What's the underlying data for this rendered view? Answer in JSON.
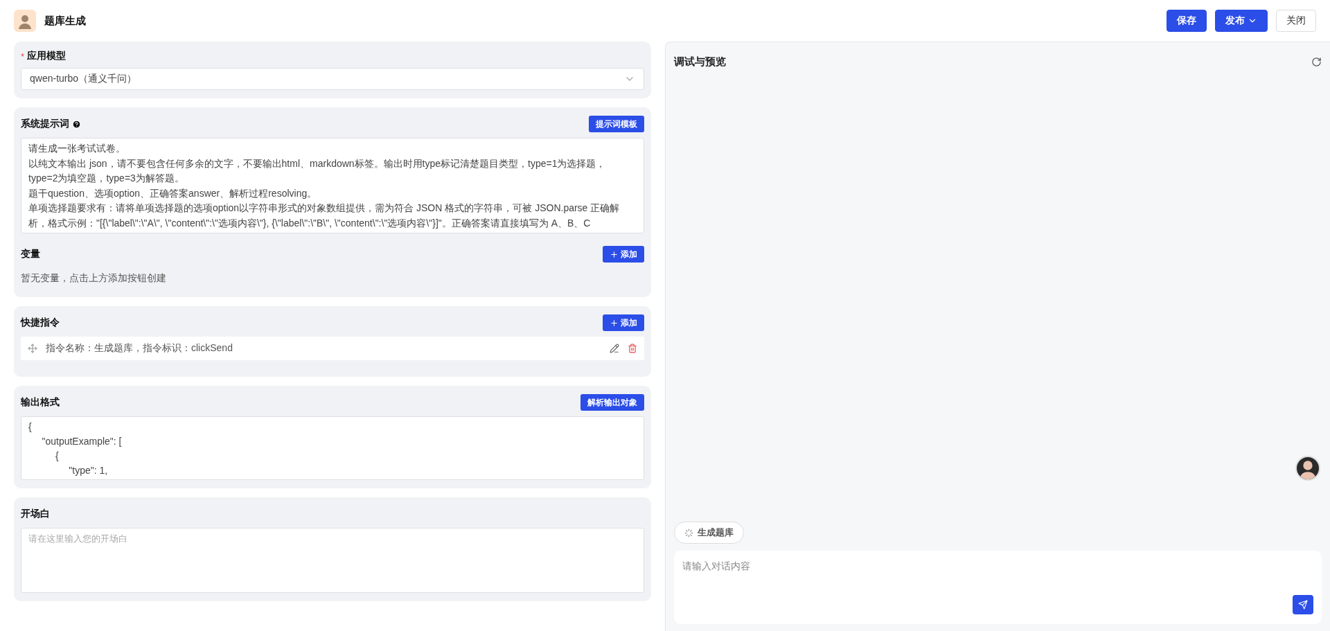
{
  "header": {
    "title": "题库生成",
    "buttons": [
      {
        "label": "保存",
        "kind": "primary"
      },
      {
        "label": "发布",
        "kind": "dropdown"
      },
      {
        "label": "关闭",
        "kind": "default"
      }
    ]
  },
  "model": {
    "mark": "*",
    "label": "应用模型",
    "value": "qwen-turbo（通义千问）"
  },
  "prompt": {
    "label": "系统提示词",
    "button": "提示词模板",
    "lines": [
      "请生成一张考试试卷。",
      "以纯文本输出 json，请不要包含任何多余的文字，不要输出html、markdown标签。输出时用type标记清楚题目类型，type=1为选择题，",
      "type=2为填空题，type=3为解答题。",
      "题干question、选项option、正确答案answer、解析过程resolving。",
      "单项选择题要求有：请将单项选择题的选项option以字符串形式的对象数组提供，需为符合 JSON 格式的字符串，可被 JSON.parse 正确解",
      "析，格式示例：\"[{\\\"label\\\":\\\"A\\\", \\\"content\\\":\\\"选项内容\\\"}, {\\\"label\\\":\\\"B\\\", \\\"content\\\":\\\"选项内容\\\"}]\"。正确答案请直接填写为 A、B、C"
    ]
  },
  "variables": {
    "label": "变量",
    "button": "添加",
    "empty": "暂无变量，点击上方添加按钮创建"
  },
  "shortcuts": {
    "label": "快捷指令",
    "button": "添加",
    "items": [
      {
        "text": "指令名称：生成题库，指令标识：clickSend"
      }
    ]
  },
  "output_format": {
    "label": "输出格式",
    "button": "解析输出对象",
    "code": "{\n\t\"outputExample\": [\n\t\t{\n\t\t\t\"type\": 1,"
  },
  "opening": {
    "label": "开场白",
    "placeholder": "请在这里输入您的开场白"
  },
  "preview": {
    "title": "调试与预览",
    "quick_action": "生成题库",
    "input_placeholder": "请输入对话内容"
  }
}
